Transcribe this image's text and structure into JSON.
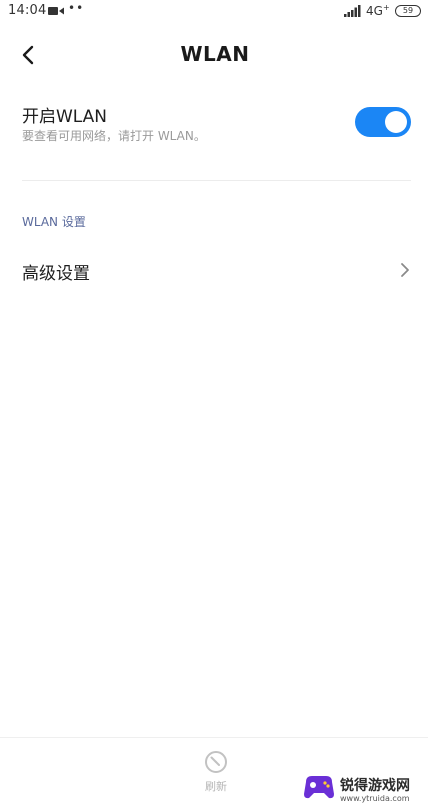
{
  "status_bar": {
    "time": "14:04",
    "dots": "••",
    "network": "4G",
    "network_super": "+",
    "battery": "59"
  },
  "header": {
    "title": "WLAN",
    "back_icon": "chevron-left-icon"
  },
  "wlan_toggle": {
    "label": "开启WLAN",
    "description": "要查看可用网络，请打开 WLAN。",
    "enabled": true,
    "accent_color": "#1b86f5"
  },
  "section": {
    "header": "WLAN 设置"
  },
  "advanced": {
    "label": "高级设置",
    "icon": "chevron-right-icon"
  },
  "bottom_bar": {
    "refresh_label": "刷新",
    "refresh_icon": "refresh-icon"
  },
  "watermark": {
    "name": "锐得游戏网",
    "url": "www.ytruida.com"
  }
}
